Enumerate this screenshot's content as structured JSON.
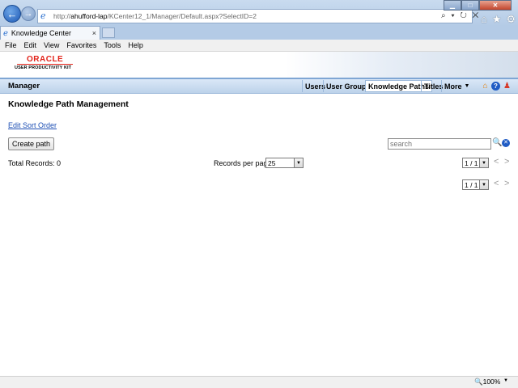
{
  "browser": {
    "url_prefix": "http://",
    "url_host": "ahufford-lap",
    "url_path": "/KCenter12_1/Manager/Default.aspx?SelectID=2",
    "tab_title": "Knowledge Center",
    "tab_close": "×",
    "addr_tools": "⌕ ▾ ↻ ✕",
    "menu": [
      "File",
      "Edit",
      "View",
      "Favorites",
      "Tools",
      "Help"
    ],
    "zoom": "100%"
  },
  "app": {
    "logo_primary": "ORACLE",
    "logo_secondary": "USER PRODUCTIVITY KIT",
    "section_title": "Manager",
    "nav": {
      "users": "Users",
      "user_groups": "User Groups",
      "knowledge_paths": "Knowledge Paths",
      "titles": "Titles",
      "more": "More"
    }
  },
  "main": {
    "page_title": "Knowledge Path Management",
    "sort_link": "Edit Sort Order",
    "create_button": "Create path",
    "search_placeholder": "search",
    "total_records": "Total Records: 0",
    "records_per_page_label": "Records per page:",
    "records_per_page_value": "25",
    "pager_value": "1 / 1",
    "prev": "<",
    "next": ">"
  }
}
